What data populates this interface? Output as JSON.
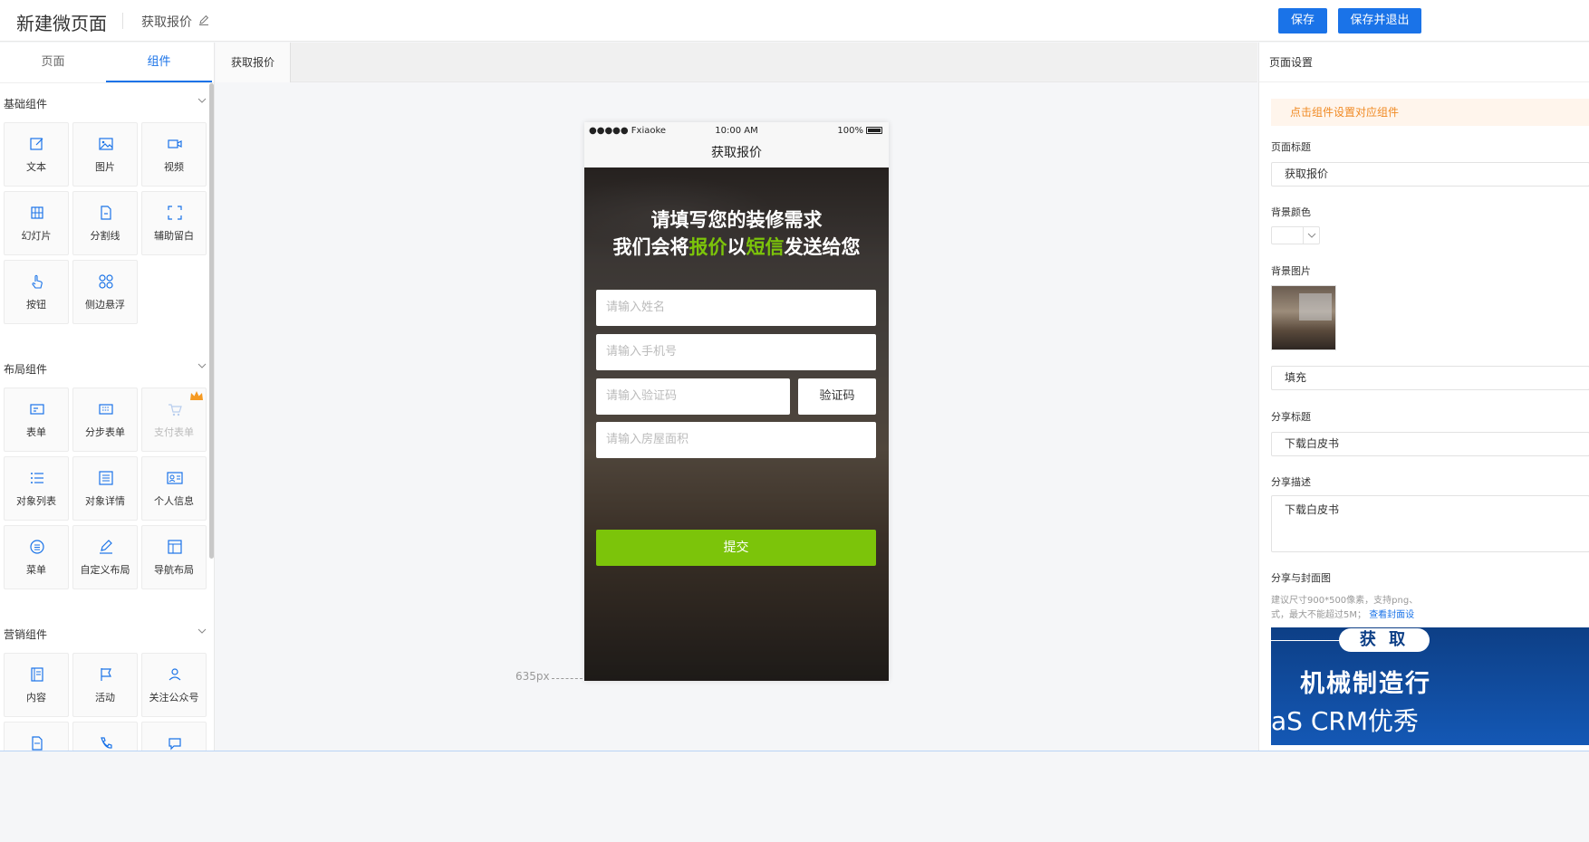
{
  "header": {
    "app_title": "新建微页面",
    "page_name": "获取报价",
    "save_label": "保存",
    "save_exit_label": "保存并退出"
  },
  "left_panel": {
    "tabs": [
      "页面",
      "组件"
    ],
    "active_tab": "组件",
    "sections": [
      {
        "title": "基础组件",
        "items": [
          "文本",
          "图片",
          "视频",
          "幻灯片",
          "分割线",
          "辅助留白",
          "按钮",
          "侧边悬浮"
        ]
      },
      {
        "title": "布局组件",
        "items": [
          "表单",
          "分步表单",
          "支付表单",
          "对象列表",
          "对象详情",
          "个人信息",
          "菜单",
          "自定义布局",
          "导航布局"
        ]
      },
      {
        "title": "营销组件",
        "items": [
          "内容",
          "活动",
          "关注公众号"
        ]
      }
    ]
  },
  "canvas": {
    "tab_label": "获取报价",
    "height_label": "635px",
    "phone": {
      "carrier": "●●●●● Fxiaoke",
      "time": "10:00 AM",
      "battery": "100%",
      "nav_title": "获取报价",
      "headline_1": "请填写您的装修需求",
      "headline_2_a": "我们会将",
      "headline_2_b": "报价",
      "headline_2_c": "以",
      "headline_2_d": "短信",
      "headline_2_e": "发送给您",
      "placeholders": {
        "name": "请输入姓名",
        "phone": "请输入手机号",
        "code": "请输入验证码",
        "area": "请输入房屋面积"
      },
      "verify_label": "验证码",
      "submit_label": "提交",
      "accent_color": "#7cc40a"
    }
  },
  "right_panel": {
    "title": "页面设置",
    "tip": "点击组件设置对应组件",
    "page_title_label": "页面标题",
    "page_title_value": "获取报价",
    "bg_color_label": "背景颜色",
    "bg_image_label": "背景图片",
    "fill_mode": "填充",
    "share_title_label": "分享标题",
    "share_title_value": "下载白皮书",
    "share_desc_label": "分享描述",
    "share_desc_value": "下载白皮书",
    "cover_label": "分享与封面图",
    "hint_line1": "建议尺寸900*500像素，支持png、",
    "hint_line2": "式，最大不能超过5M；",
    "hint_link": "查看封面设",
    "cover_text_1": "获 取",
    "cover_text_2": "机械制造行",
    "cover_text_3": "aS CRM优秀"
  },
  "colors": {
    "primary": "#1a73e8",
    "tip_bg": "#fff5ec",
    "tip_text": "#f08a24",
    "crown": "#f59a23"
  }
}
